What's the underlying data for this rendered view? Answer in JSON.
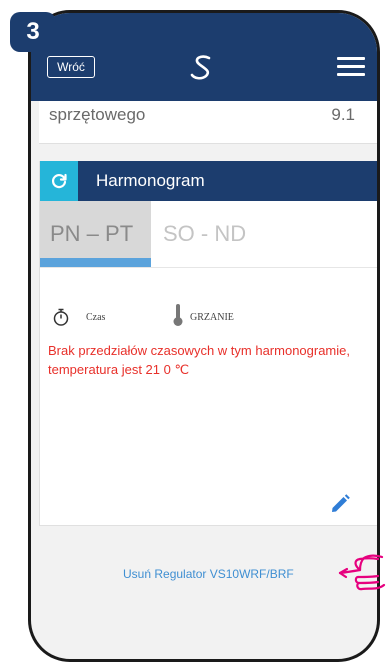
{
  "step_number": "3",
  "header": {
    "back_label": "Wróć",
    "logo_icon": "salus-logo-icon",
    "menu_icon": "hamburger-menu-icon"
  },
  "info_row": {
    "label": "sprzętowego",
    "value": "9.1"
  },
  "schedule": {
    "icon": "schedule-cycle-icon",
    "title": "Harmonogram",
    "tabs": [
      {
        "label": "PN – PT",
        "active": true
      },
      {
        "label": "SO - ND",
        "active": false
      }
    ],
    "time_label": "Czas",
    "time_icon": "stopwatch-icon",
    "heating_label": "GRZANIE",
    "heating_icon": "thermometer-icon",
    "empty_message": "Brak przedziałów czasowych w tym harmonogramie, temperatura jest 21 0 ℃",
    "edit_icon": "pencil-edit-icon"
  },
  "delete_link": "Usuń Regulator VS10WRF/BRF",
  "pointer_icon": "pointing-hand-icon",
  "colors": {
    "header_bg": "#1c3d6e",
    "accent_cyan": "#25b5d9",
    "active_tab_bar": "#5ba3dc",
    "warning_red": "#e8302a",
    "link_blue": "#3f8fd2",
    "hand_magenta": "#e6007e"
  }
}
